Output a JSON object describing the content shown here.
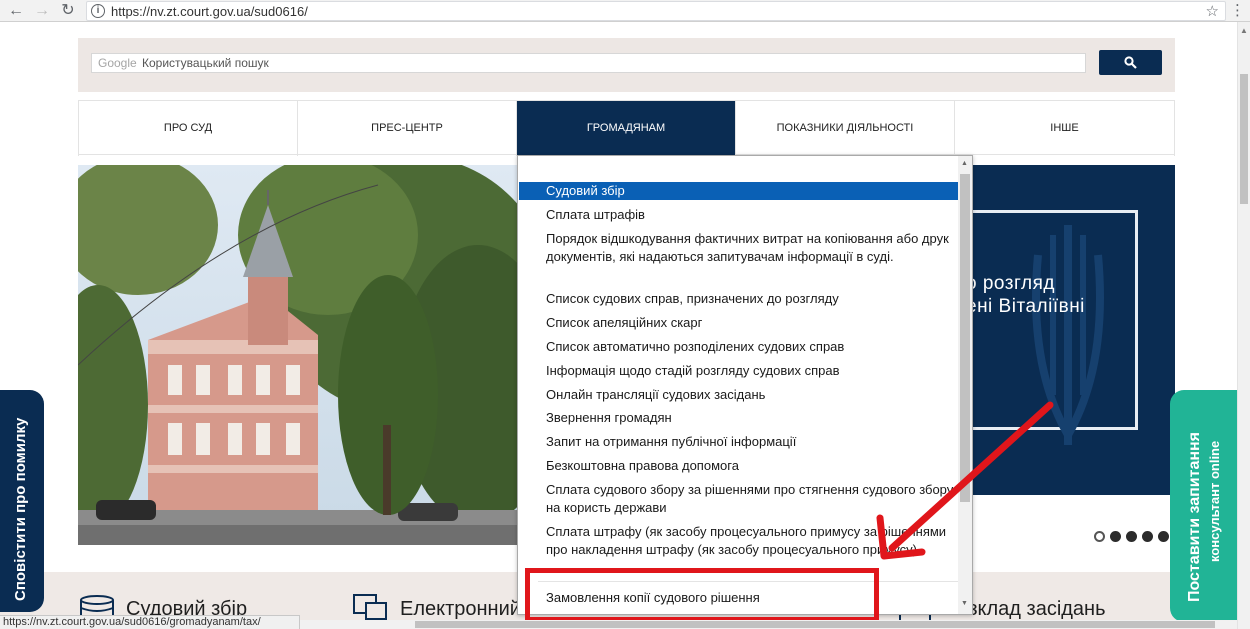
{
  "browser": {
    "url": "https://nv.zt.court.gov.ua/sud0616/"
  },
  "search": {
    "brand": "Google",
    "placeholder": "Користувацький пошук"
  },
  "nav": {
    "items": [
      {
        "label": "ПРО СУД"
      },
      {
        "label": "ПРЕС-ЦЕНТР"
      },
      {
        "label": "ГРОМАДЯНАМ",
        "active": true
      },
      {
        "label": "ПОКАЗНИКИ ДІЯЛЬНОСТІ"
      },
      {
        "label": "ІНШЕ"
      }
    ]
  },
  "dropdown": {
    "items": [
      "Судовий збір",
      "Сплата штрафів",
      "Порядок відшкодування фактичних витрат на копіювання або друк документів, які надаються запитувачам інформації в суді.",
      "Список судових справ, призначених до розгляду",
      "Список апеляційних скарг",
      "Список автоматично розподілених судових справ",
      "Інформація щодо стадій розгляду судових справ",
      "Онлайн трансляції судових засідань",
      "Звернення громадян",
      "Запит на отримання публічної інформації",
      "Безкоштовна правова допомога",
      "Сплата судового збору за рішеннями про стягнення судового збору на користь держави",
      "Сплата штрафу (як засобу процесуального примусу за рішеннями про накладення штрафу (як засобу процесуального примусу)",
      "Замовлення копії судового рішення"
    ],
    "selected_index": 0
  },
  "banner": {
    "line1": "о розгляд",
    "line2": "ені Віталіївні"
  },
  "side_left": {
    "label": "Сповістити про помилку"
  },
  "side_right": {
    "label1": "Поставити запитання",
    "label2": "консультант online"
  },
  "bottom": {
    "items": [
      "Судовий збір",
      "Електронний",
      "Розклад засідань"
    ]
  },
  "status": {
    "url": "https://nv.zt.court.gov.ua/sud0616/gromadyanam/tax/"
  },
  "colors": {
    "navy": "#0a2c52",
    "selected": "#0a60b5",
    "accent_green": "#21b496",
    "annotation_red": "#e0161b"
  }
}
